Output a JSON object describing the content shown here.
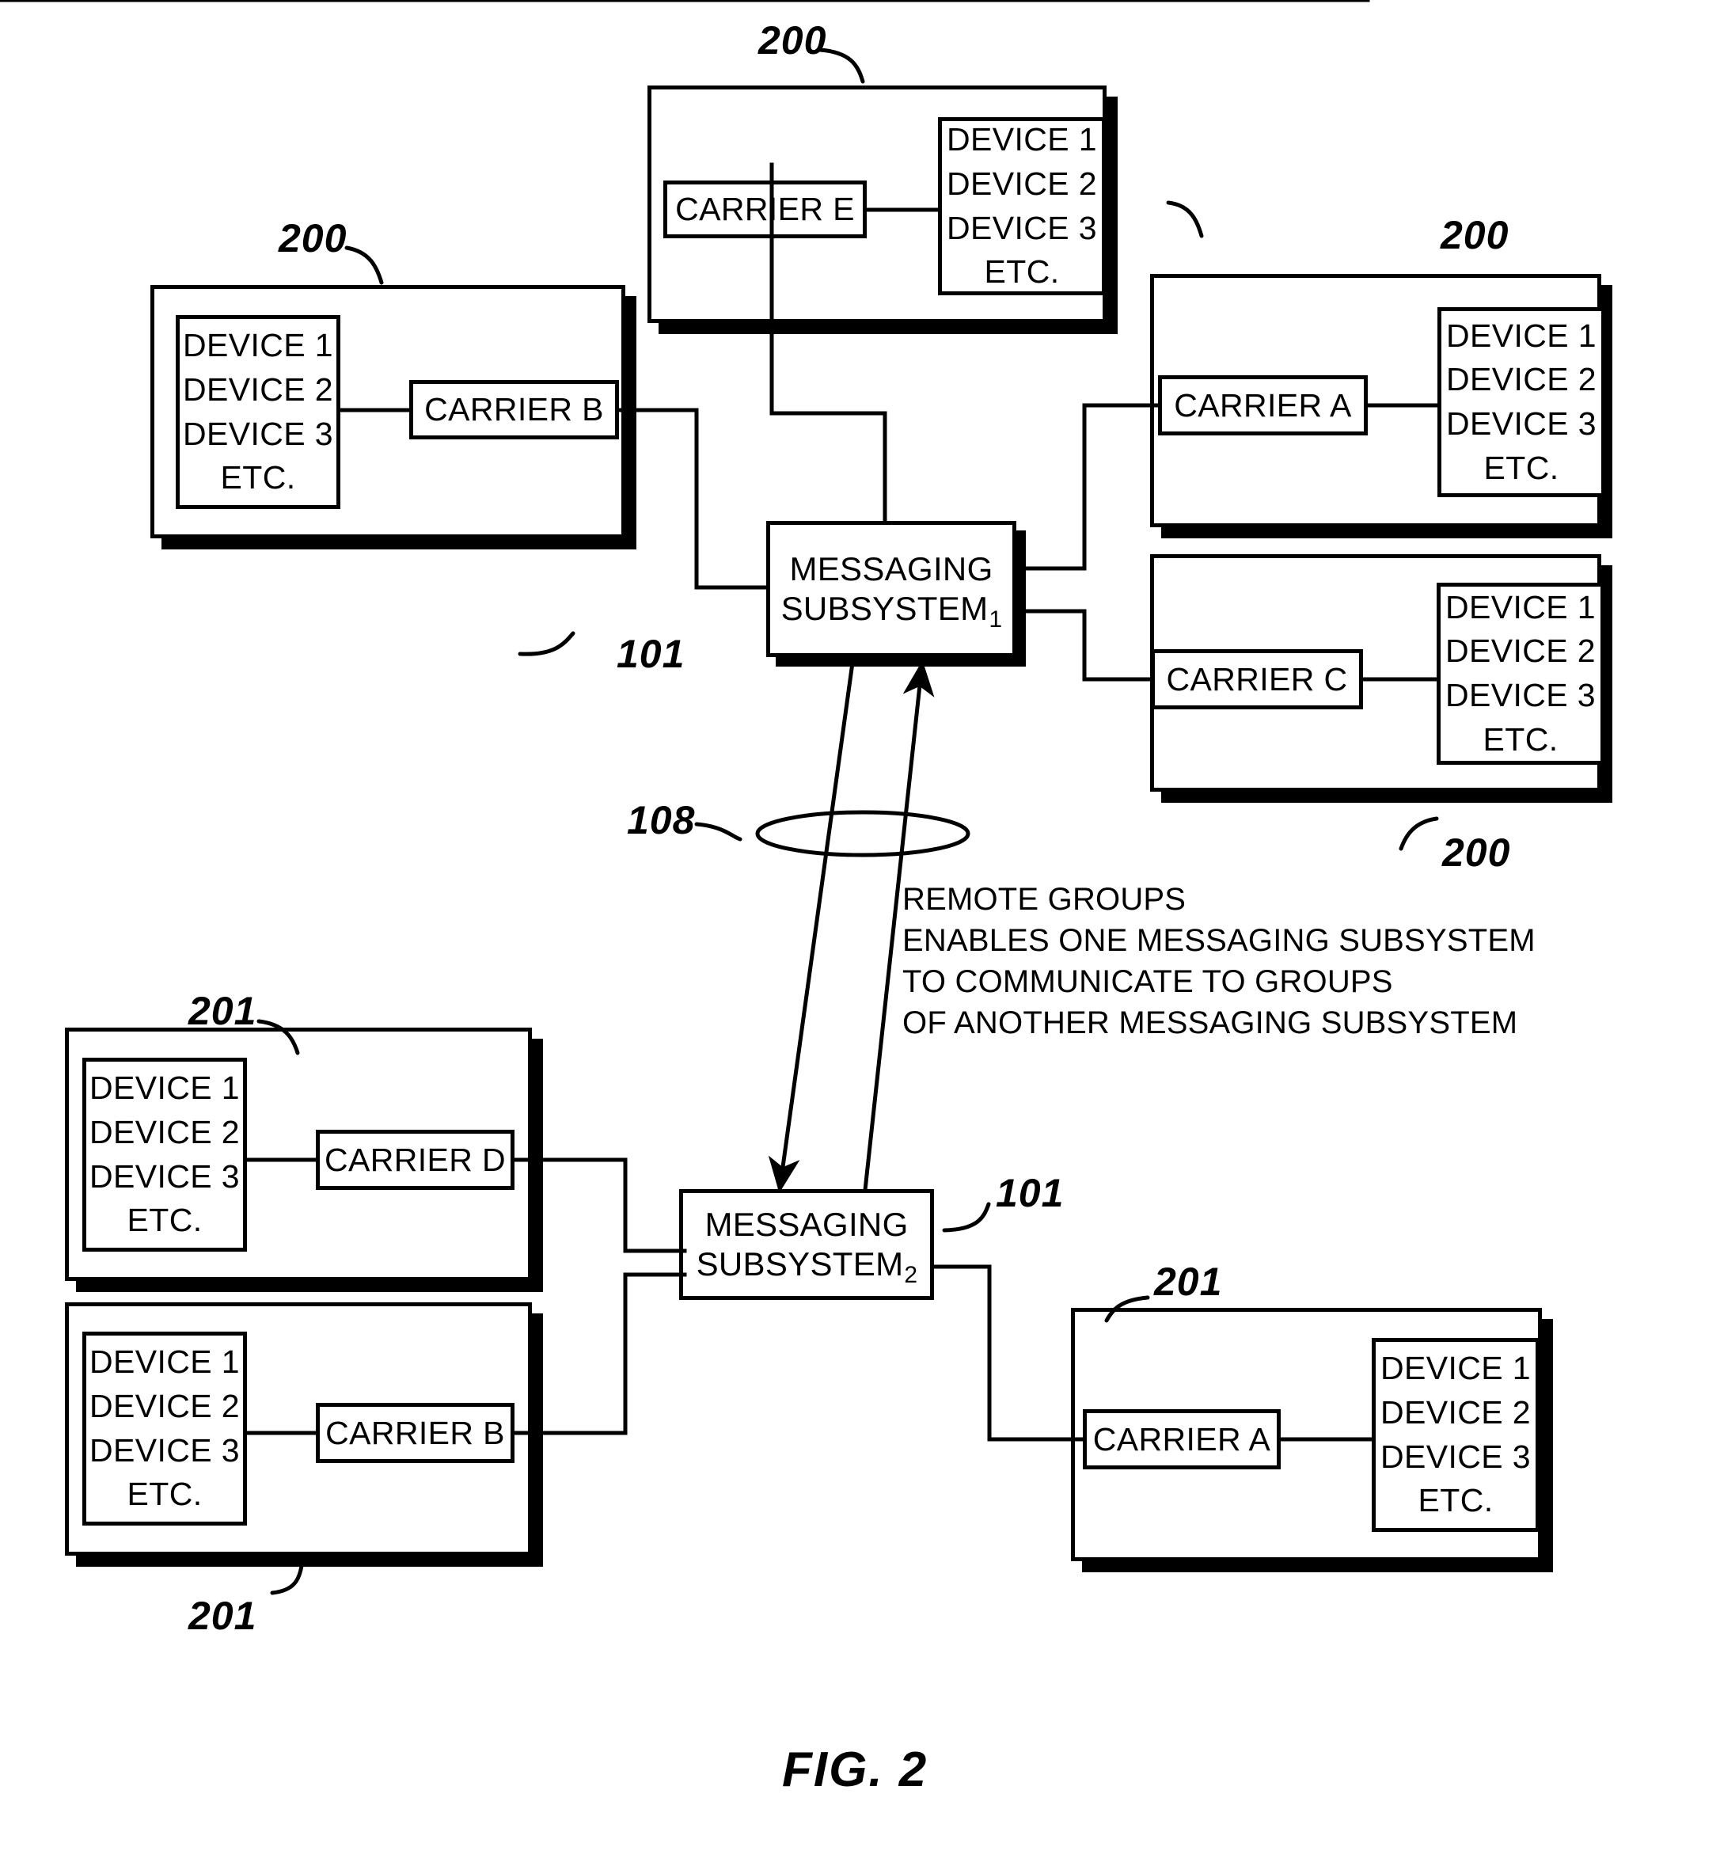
{
  "figure": {
    "caption": "FIG. 2"
  },
  "device_list": {
    "items": [
      "DEVICE 1",
      "DEVICE 2",
      "DEVICE 3",
      "ETC."
    ]
  },
  "refs": {
    "group_top_left": "200",
    "group_top_center": "200",
    "group_top_right": "200",
    "group_right_lower": "200",
    "subsystem_1": "101",
    "subsystem_2": "101",
    "link_108": "108",
    "group_bottom_left_upper": "201",
    "group_bottom_left_lower": "201",
    "group_bottom_right": "201"
  },
  "groups": {
    "top_center": {
      "carrier": "CARRIER E",
      "ref": "200"
    },
    "top_left": {
      "carrier": "CARRIER B",
      "ref": "200"
    },
    "right_upper": {
      "carrier": "CARRIER A",
      "ref": "200"
    },
    "right_lower": {
      "carrier": "CARRIER C",
      "ref": "200"
    },
    "bottom_left_upper": {
      "carrier": "CARRIER D",
      "ref": "201"
    },
    "bottom_left_lower": {
      "carrier": "CARRIER B",
      "ref": "201"
    },
    "bottom_right": {
      "carrier": "CARRIER A",
      "ref": "201"
    }
  },
  "subsystems": {
    "one": {
      "line1": "MESSAGING",
      "line2": "SUBSYSTEM",
      "subscript": "1",
      "ref": "101"
    },
    "two": {
      "line1": "MESSAGING",
      "line2": "SUBSYSTEM",
      "subscript": "2",
      "ref": "101"
    }
  },
  "annotation": {
    "line1": "REMOTE GROUPS",
    "line2": "ENABLES ONE MESSAGING SUBSYSTEM",
    "line3": "TO COMMUNICATE TO GROUPS",
    "line4": "OF ANOTHER MESSAGING SUBSYSTEM"
  },
  "colors": {
    "ink": "#000000",
    "paper": "#ffffff"
  }
}
